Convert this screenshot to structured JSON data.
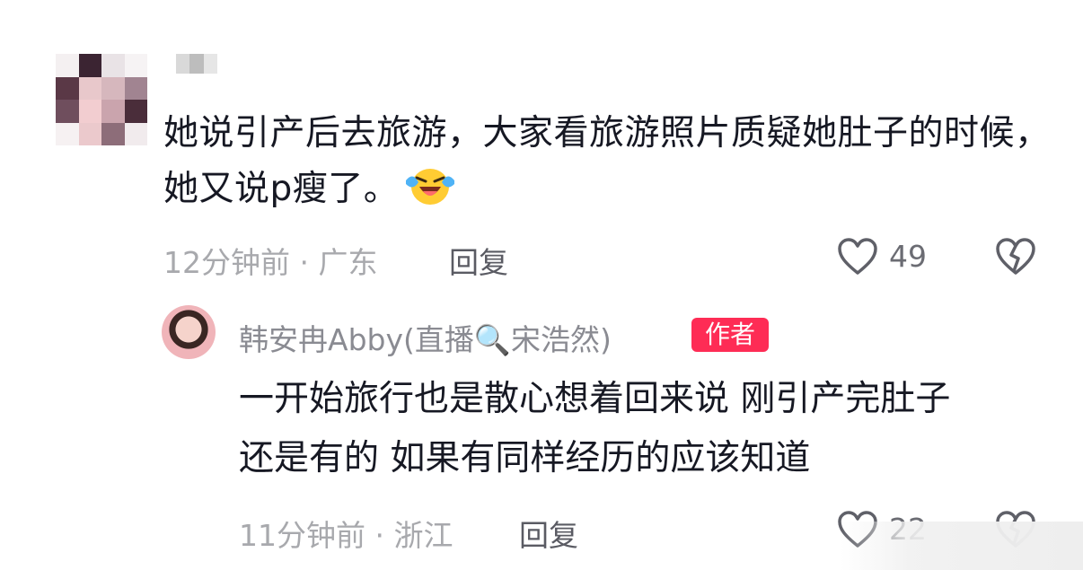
{
  "comments": [
    {
      "text": "她说引产后去旅游，大家看旅游照片质疑她肚子的时候，她又说p瘦了。",
      "time": "12分钟前",
      "location": "广东",
      "reply_label": "回复",
      "likes": "49"
    }
  ],
  "reply": {
    "author_name": "韩安冉Abby(直播🔍宋浩然)",
    "badge": "作者",
    "text_line1": "一开始旅行也是散心想着回来说 刚引产完肚子",
    "text_line2": "还是有的 如果有同样经历的应该知道",
    "time": "11分钟前",
    "location": "浙江",
    "reply_label": "回复",
    "likes": "22"
  },
  "colors": {
    "accent": "#fe2c55",
    "meta": "#a8a9ad",
    "text": "#161823"
  },
  "icons": {
    "emoji": "laughing-crying-face-emoji",
    "like": "heart-outline-icon",
    "dislike": "broken-heart-icon"
  }
}
